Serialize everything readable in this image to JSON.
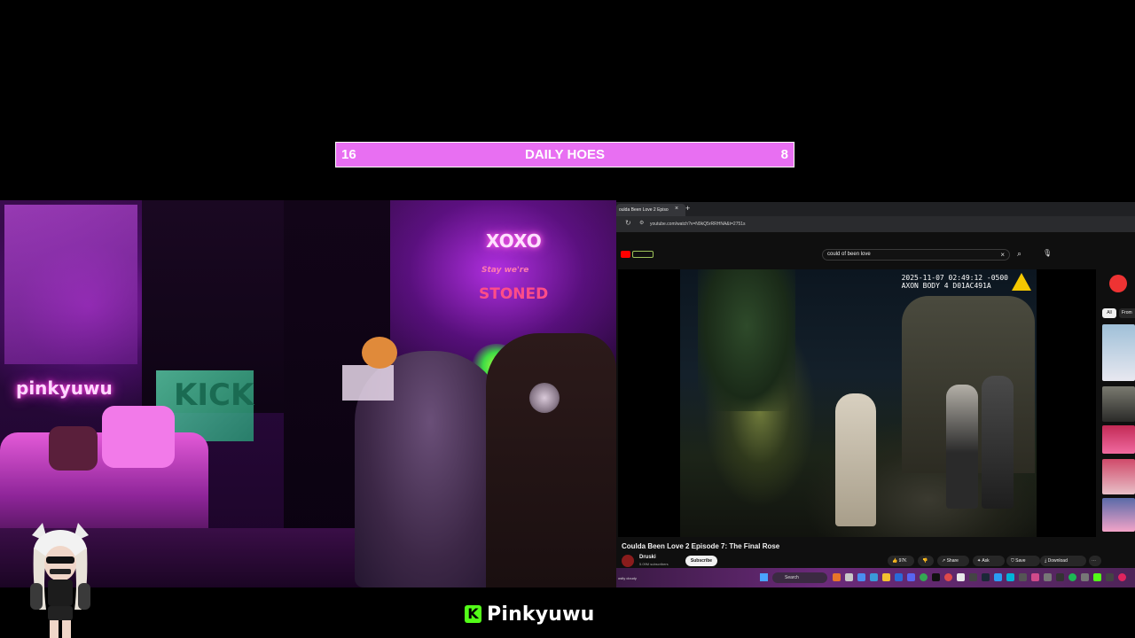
{
  "goal": {
    "left": "16",
    "title": "DAILY HOES",
    "right": "8",
    "color": "#e86ff2"
  },
  "webcam": {
    "neon_signs": {
      "name": "pinkyuwu",
      "kick": "KICK",
      "xoxo": "XOXO",
      "stoned_top": "Stay we're",
      "stoned": "STONED"
    }
  },
  "browser": {
    "tab_label": "oulda Been Love 2 Episo",
    "url": "youtube.com/watch?v=N9kQ5rRRHNA&t=2751s",
    "search_query": "could of been love"
  },
  "player": {
    "timestamp": "2025-11-07 02:49:12 -0500",
    "device": "AXON BODY 4 D01AC491A"
  },
  "video": {
    "title": "Coulda Been Love 2 Episode 7: The Final Rose",
    "channel": "Druski",
    "subscribers": "5.09M subscribers",
    "subscribe_label": "Subscribe",
    "likes": "97K",
    "share_label": "Share",
    "ask_label": "Ask",
    "save_label": "Save",
    "download_label": "Download"
  },
  "sidebar": {
    "chip_all": "All",
    "chip_from": "From"
  },
  "taskbar": {
    "weather": "ostly cloudy",
    "search": "Search"
  },
  "brand": {
    "logo_letter": "K",
    "name": "Pinkyuwu",
    "accent": "#53fc18"
  }
}
